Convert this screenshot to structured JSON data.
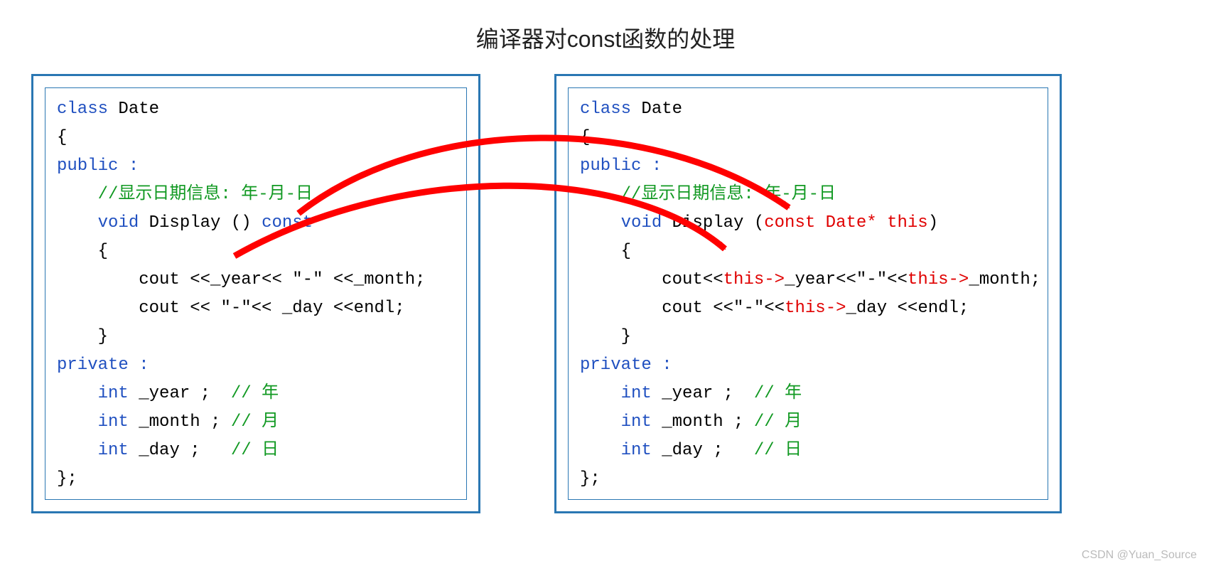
{
  "title": "编译器对const函数的处理",
  "watermark": "CSDN @Yuan_Source",
  "colors": {
    "border": "#2a77b3",
    "keyword": "#2050c0",
    "comment": "#119922",
    "highlight": "#e00000",
    "arrow": "#ff0000"
  },
  "left": {
    "class_kw": "class",
    "class_name": "Date",
    "brace_open": "{",
    "public": "public :",
    "comment1": "//显示日期信息: 年-月-日",
    "void": "void",
    "display": "Display ()",
    "const": "const",
    "fn_brace_open": "{",
    "cout1a": "cout <<_year<< ",
    "dash1": "\"-\"",
    "cout1b": " <<_month;",
    "cout2a": "cout << ",
    "dash2": "\"-\"",
    "cout2b": "<< _day <<endl;",
    "fn_brace_close": "}",
    "private": "private :",
    "int": "int",
    "year": "_year ;",
    "cmt_y": "// 年",
    "month": "_month ;",
    "cmt_m": "// 月",
    "day": "_day ;",
    "cmt_d": "// 日",
    "brace_close": "};"
  },
  "right": {
    "class_kw": "class",
    "class_name": "Date",
    "brace_open": "{",
    "public": "public :",
    "comment1": "//显示日期信息: 年-月-日",
    "void": "void",
    "display": "Display (",
    "param": "const Date* this",
    "display_close": ")",
    "fn_brace_open": "{",
    "cout1a": "cout<<",
    "this1": "this->",
    "year": "_year<<",
    "dash1": "\"-\"",
    "ins1": "<<",
    "this2": "this->",
    "month": "_month;",
    "cout2a": "cout <<",
    "dash2": "\"-\"",
    "ins2": "<<",
    "this3": "this->",
    "day": "_day <<endl;",
    "fn_brace_close": "}",
    "private": "private :",
    "int": "int",
    "y": "_year ;",
    "cmt_y": "// 年",
    "m": "_month ;",
    "cmt_m": "// 月",
    "d": "_day ;",
    "cmt_d": "// 日",
    "brace_close": "};"
  }
}
